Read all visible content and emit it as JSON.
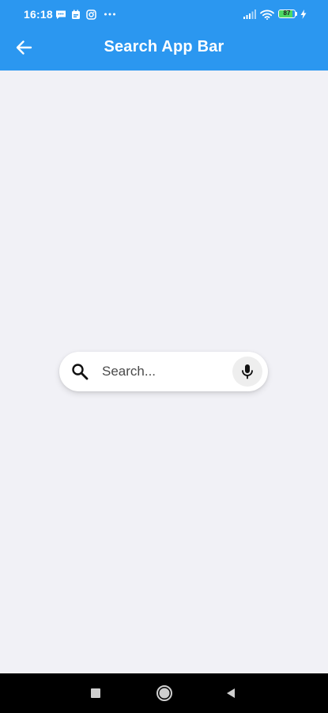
{
  "status_bar": {
    "time": "16:18",
    "battery_level": "87",
    "icons": [
      "message-icon",
      "calendar-icon",
      "instagram-icon",
      "more-dots-icon",
      "signal-icon",
      "wifi-icon",
      "battery-icon",
      "charging-icon"
    ]
  },
  "app_bar": {
    "title": "Search App Bar",
    "back_icon": "arrow-back-icon"
  },
  "search": {
    "placeholder": "Search...",
    "value": "",
    "leading_icon": "search-icon",
    "trailing_icon": "mic-icon"
  },
  "nav_bar": {
    "buttons": [
      "recents-square-icon",
      "home-circle-icon",
      "back-triangle-icon"
    ]
  },
  "colors": {
    "app_bar": "#2b97f0",
    "background": "#f1f1f6",
    "search_surface": "#ffffff",
    "mic_background": "#eeeeee",
    "nav_bar": "#000000",
    "battery_fill": "#4cd964"
  }
}
